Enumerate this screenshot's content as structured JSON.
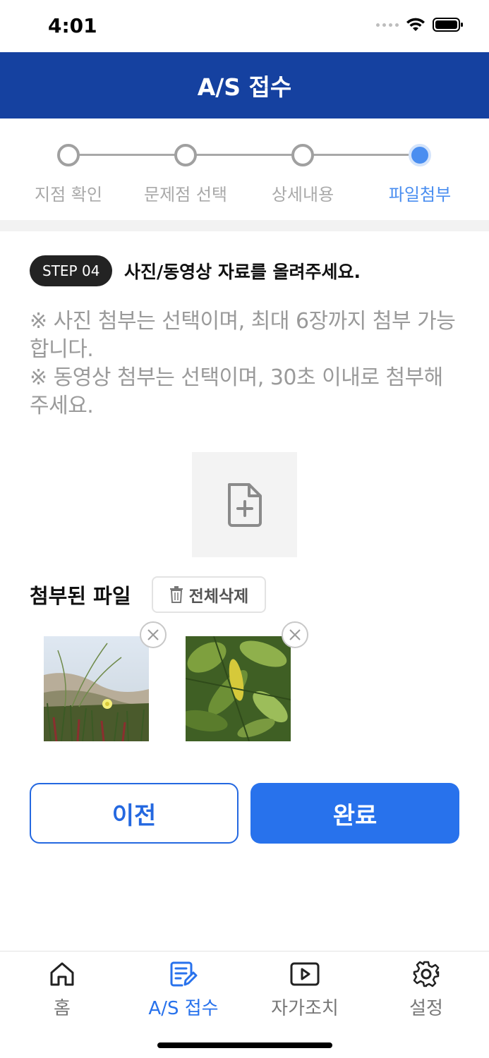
{
  "status_bar": {
    "time": "4:01"
  },
  "header": {
    "title": "A/S 접수"
  },
  "stepper": {
    "steps": [
      {
        "label": "지점 확인"
      },
      {
        "label": "문제점 선택"
      },
      {
        "label": "상세내용"
      },
      {
        "label": "파일첨부"
      }
    ],
    "current_step": 4
  },
  "step_badge": "STEP 04",
  "step_title": "사진/동영상 자료를 올려주세요.",
  "notice": {
    "line1": "※ 사진 첨부는 선택이며, 최대 6장까지 첨부 가능합니다.",
    "line2": "※ 동영상 첨부는 선택이며, 30초 이내로 첨부해주세요."
  },
  "attached": {
    "title": "첨부된 파일",
    "delete_all_label": "전체삭제",
    "files": [
      {
        "icon": "photo-plant-flower"
      },
      {
        "icon": "photo-green-leaves"
      }
    ]
  },
  "buttons": {
    "prev": "이전",
    "done": "완료"
  },
  "tabbar": {
    "items": [
      {
        "label": "홈",
        "icon": "home-icon"
      },
      {
        "label": "A/S 접수",
        "icon": "document-edit-icon"
      },
      {
        "label": "자가조치",
        "icon": "play-icon"
      },
      {
        "label": "설정",
        "icon": "gear-icon"
      }
    ],
    "active": 1
  },
  "colors": {
    "header": "#1541a0",
    "accent": "#2872ec",
    "active_step": "#4a8ef0"
  }
}
